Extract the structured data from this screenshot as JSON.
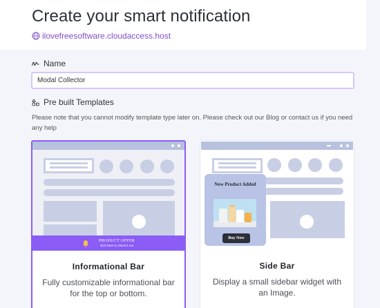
{
  "header": {
    "title": "Create your smart notification",
    "site_url": "ilovefreesoftware.cloudaccess.host"
  },
  "name_field": {
    "label": "Name",
    "value": "Modal Collector"
  },
  "templates": {
    "label": "Pre built Templates",
    "note": "Please note that you cannot modify template type later on. Please check out our Blog or contact us if you need any help",
    "cards": [
      {
        "title": "Informational Bar",
        "description": "Fully customizable informational bar for the top or bottom.",
        "selected": true,
        "preview": {
          "offer_title": "PRODUCT OFFER",
          "offer_subtitle": "click here to check it out"
        }
      },
      {
        "title": "Side Bar",
        "description": "Display a small sidebar widget with an Image.",
        "selected": false,
        "preview": {
          "widget_title": "New Product Added",
          "widget_button": "Buy Now"
        }
      }
    ]
  },
  "colors": {
    "accent": "#8b5cf6",
    "link": "#7b4fc7",
    "wireframe": "#c8cfe5",
    "browser_bar": "#b8c1dd"
  }
}
